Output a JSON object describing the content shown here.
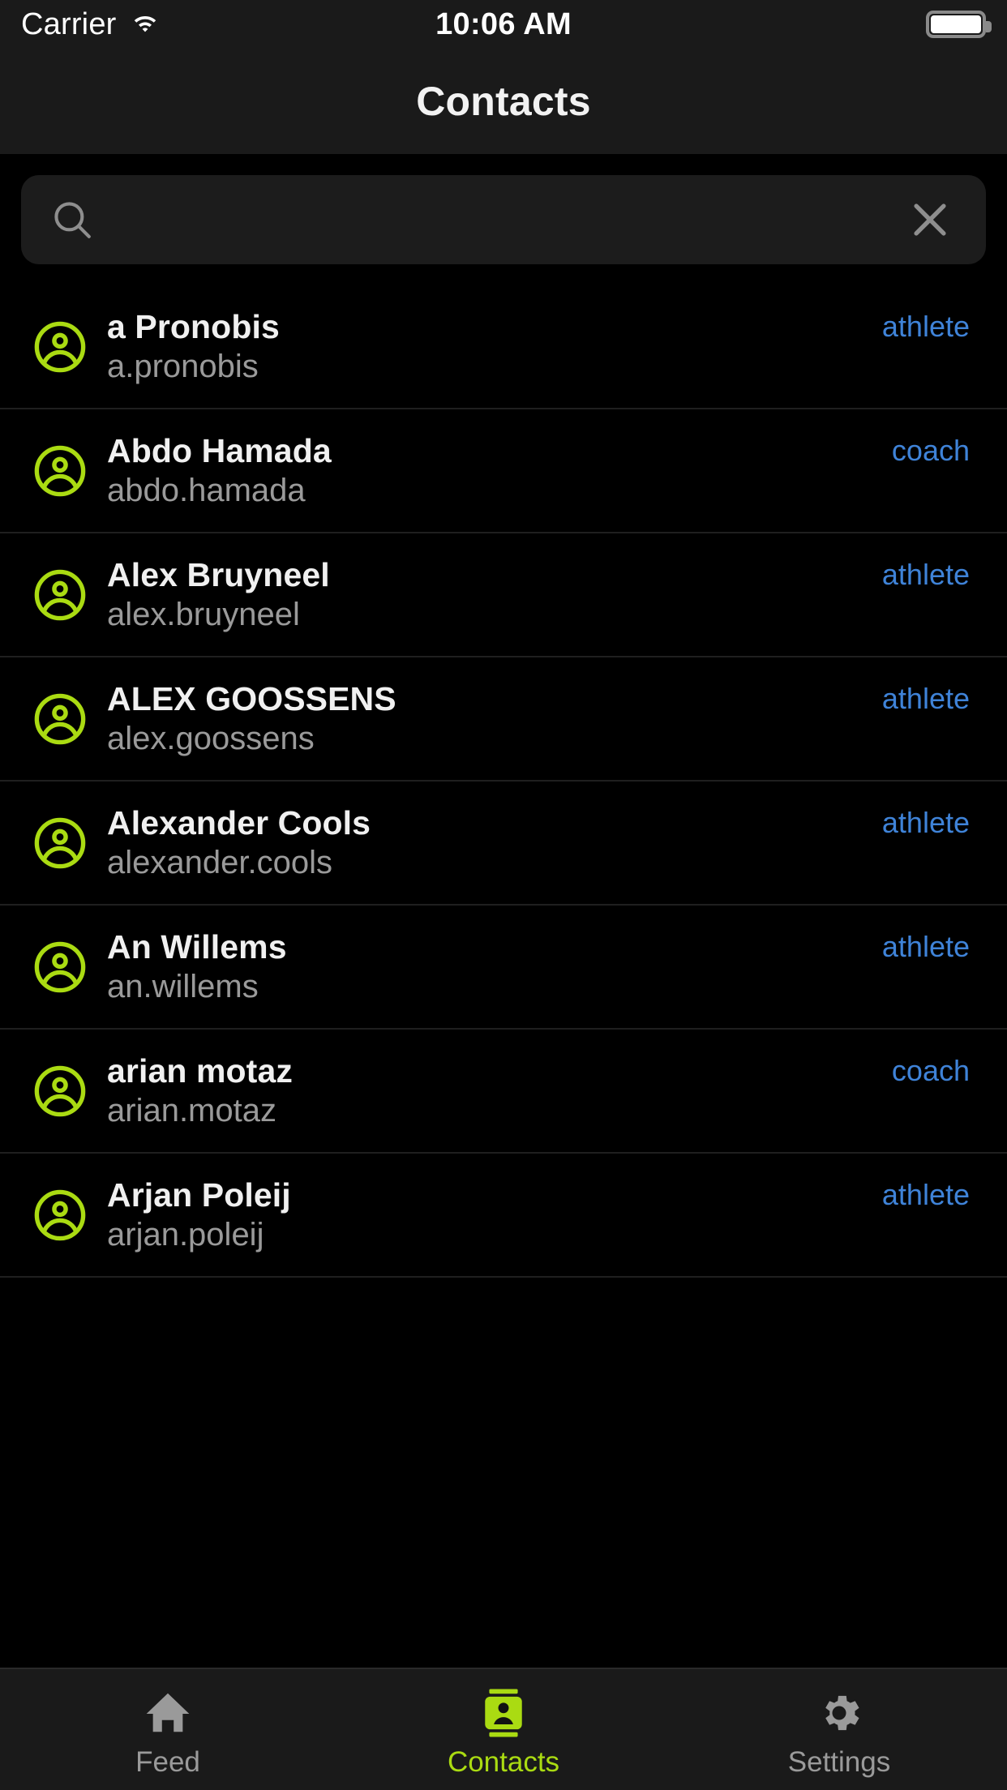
{
  "statusbar": {
    "carrier": "Carrier",
    "time": "10:06 AM",
    "wifi_icon": "wifi-icon",
    "battery_icon": "battery-full-icon"
  },
  "navbar": {
    "title": "Contacts"
  },
  "search": {
    "value": "",
    "placeholder": "",
    "search_icon": "search-icon",
    "clear_icon": "close-icon"
  },
  "colors": {
    "accent_lime": "#aadb12",
    "role_blue": "#3f83d8",
    "background": "#000000",
    "chrome": "#1a1a1a",
    "field": "#1c1c1c",
    "separator": "#1f1f1f",
    "name_text": "#f0f0f0",
    "username_text": "#9a9a9a",
    "tab_inactive": "#9a9a9a"
  },
  "contacts": [
    {
      "name": "a Pronobis",
      "username": "a.pronobis",
      "role": "athlete"
    },
    {
      "name": "Abdo Hamada",
      "username": "abdo.hamada",
      "role": "coach"
    },
    {
      "name": "Alex Bruyneel",
      "username": "alex.bruyneel",
      "role": "athlete"
    },
    {
      "name": "ALEX GOOSSENS",
      "username": "alex.goossens",
      "role": "athlete"
    },
    {
      "name": "Alexander Cools",
      "username": "alexander.cools",
      "role": "athlete"
    },
    {
      "name": "An Willems",
      "username": "an.willems",
      "role": "athlete"
    },
    {
      "name": "arian motaz",
      "username": "arian.motaz",
      "role": "coach"
    },
    {
      "name": "Arjan Poleij",
      "username": "arjan.poleij",
      "role": "athlete"
    }
  ],
  "tabbar": {
    "items": [
      {
        "label": "Feed",
        "icon": "home-icon",
        "active": false
      },
      {
        "label": "Contacts",
        "icon": "contact-card-icon",
        "active": true
      },
      {
        "label": "Settings",
        "icon": "gear-icon",
        "active": false
      }
    ]
  }
}
